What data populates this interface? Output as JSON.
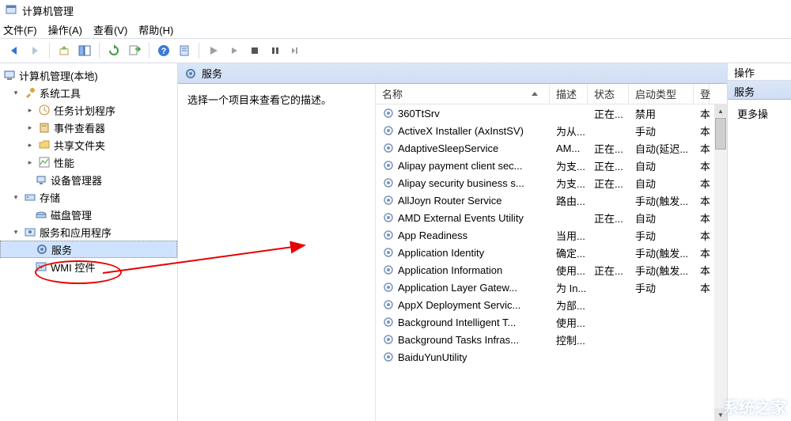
{
  "window": {
    "title": "计算机管理"
  },
  "menu": {
    "file": "文件(F)",
    "action": "操作(A)",
    "view": "查看(V)",
    "help": "帮助(H)"
  },
  "tree": {
    "root": "计算机管理(本地)",
    "g1": "系统工具",
    "i11": "任务计划程序",
    "i12": "事件查看器",
    "i13": "共享文件夹",
    "i14": "性能",
    "i15": "设备管理器",
    "g2": "存储",
    "i21": "磁盘管理",
    "g3": "服务和应用程序",
    "i31": "服务",
    "i32": "WMI 控件"
  },
  "center": {
    "header": "服务",
    "desc_prompt": "选择一个项目来查看它的描述。"
  },
  "columns": {
    "name": "名称",
    "desc": "描述",
    "status": "状态",
    "start": "启动类型",
    "logon": "登"
  },
  "services": [
    {
      "name": "360TtSrv",
      "desc": "",
      "status": "正在...",
      "start": "禁用",
      "logon": "本"
    },
    {
      "name": "ActiveX Installer (AxInstSV)",
      "desc": "为从...",
      "status": "",
      "start": "手动",
      "logon": "本"
    },
    {
      "name": "AdaptiveSleepService",
      "desc": "AM...",
      "status": "正在...",
      "start": "自动(延迟...",
      "logon": "本"
    },
    {
      "name": "Alipay payment client sec...",
      "desc": "为支...",
      "status": "正在...",
      "start": "自动",
      "logon": "本"
    },
    {
      "name": "Alipay security business s...",
      "desc": "为支...",
      "status": "正在...",
      "start": "自动",
      "logon": "本"
    },
    {
      "name": "AllJoyn Router Service",
      "desc": "路由...",
      "status": "",
      "start": "手动(触发...",
      "logon": "本"
    },
    {
      "name": "AMD External Events Utility",
      "desc": "",
      "status": "正在...",
      "start": "自动",
      "logon": "本"
    },
    {
      "name": "App Readiness",
      "desc": "当用...",
      "status": "",
      "start": "手动",
      "logon": "本"
    },
    {
      "name": "Application Identity",
      "desc": "确定...",
      "status": "",
      "start": "手动(触发...",
      "logon": "本"
    },
    {
      "name": "Application Information",
      "desc": "使用...",
      "status": "正在...",
      "start": "手动(触发...",
      "logon": "本"
    },
    {
      "name": "Application Layer Gatew...",
      "desc": "为 In...",
      "status": "",
      "start": "手动",
      "logon": "本"
    },
    {
      "name": "AppX Deployment Servic...",
      "desc": "为部...",
      "status": "",
      "start": "",
      "logon": ""
    },
    {
      "name": "Background Intelligent T...",
      "desc": "使用...",
      "status": "",
      "start": "",
      "logon": ""
    },
    {
      "name": "Background Tasks Infras...",
      "desc": "控制...",
      "status": "",
      "start": "",
      "logon": ""
    },
    {
      "name": "BaiduYunUtility",
      "desc": "",
      "status": "",
      "start": "",
      "logon": ""
    }
  ],
  "actions": {
    "header": "操作",
    "section": "服务",
    "more": "更多操"
  }
}
